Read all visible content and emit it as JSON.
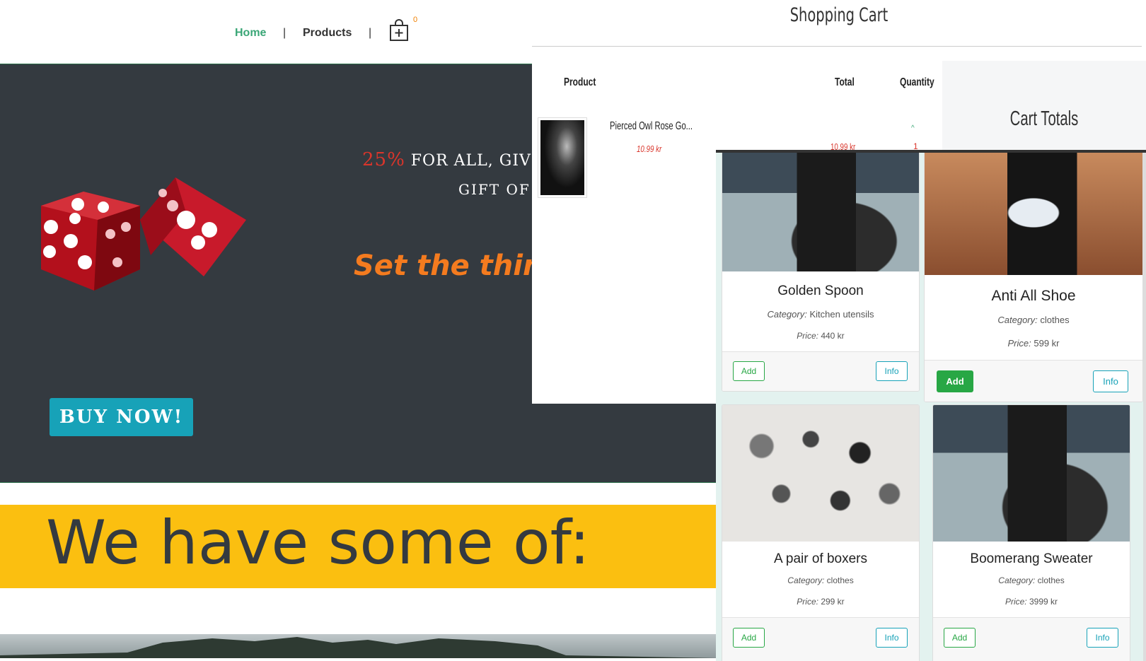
{
  "nav": {
    "home": "Home",
    "separator": "|",
    "products": "Products",
    "cart_count": "0",
    "cart_icon": "shopping-bag-plus-icon"
  },
  "hero": {
    "promo_percent": "25%",
    "promo_line1_rest": " for all, Givi",
    "promo_line2": "gift of",
    "tagline": "Set the thing",
    "buy_button": "BUY NOW!"
  },
  "banner": {
    "text": "We have some of:"
  },
  "cart": {
    "title": "Shopping Cart",
    "columns": {
      "product": "Product",
      "total": "Total",
      "quantity": "Quantity"
    },
    "item": {
      "name": "Pierced Owl Rose Go...",
      "price": "10.99 kr",
      "total": "10.99 kr",
      "quantity": "1",
      "qty_up": "^"
    },
    "totals_title": "Cart Totals"
  },
  "products": {
    "category_label": "Category:",
    "price_label": "Price:",
    "add_label": "Add",
    "info_label": "Info",
    "items": [
      {
        "title": "Golden Spoon",
        "category": "Kitchen utensils",
        "price": "440 kr"
      },
      {
        "title": "Anti All Shoe",
        "category": "clothes",
        "price": "599 kr"
      },
      {
        "title": "A pair of boxers",
        "category": "clothes",
        "price": "299 kr"
      },
      {
        "title": "Boomerang Sweater",
        "category": "clothes",
        "price": "3999 kr"
      }
    ]
  },
  "colors": {
    "nav_active": "#3aa676",
    "hero_bg": "#343a40",
    "promo_red": "#d9352b",
    "tagline_orange": "#f47b1f",
    "buy_button": "#17a2b8",
    "banner_yellow": "#fbbf10",
    "add_green": "#28a745",
    "info_teal": "#17a2b8"
  }
}
